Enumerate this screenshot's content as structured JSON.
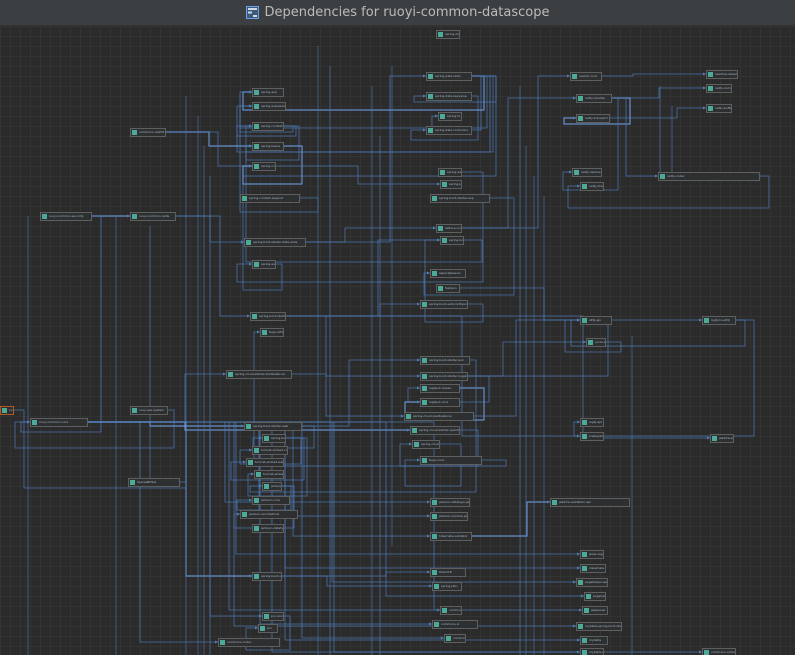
{
  "window": {
    "title": "Dependencies for ruoyi-common-datascope"
  },
  "colors": {
    "edge": "#4f7fbf",
    "edge_highlight": "#6e9fe6",
    "node_icon": "#4eaa98",
    "background": "#2b2b2b"
  },
  "nodes": [
    {
      "id": "n01",
      "label": "spring-aop"
    },
    {
      "id": "n02",
      "label": "spring-data-redis"
    },
    {
      "id": "n03",
      "label": "spring-data-keyvalue"
    },
    {
      "id": "n04",
      "label": "spring-tx"
    },
    {
      "id": "n05",
      "label": "spring-data-commons"
    },
    {
      "id": "n06",
      "label": "spring-oxm"
    },
    {
      "id": "n07",
      "label": "spring-context-support"
    },
    {
      "id": "n08",
      "label": "spring-expression"
    },
    {
      "id": "n09",
      "label": "spring-context"
    },
    {
      "id": "n10",
      "label": "spring-beans"
    },
    {
      "id": "n11",
      "label": "spring-core"
    },
    {
      "id": "n12",
      "label": "spring-jcl"
    },
    {
      "id": "n13",
      "label": "spring-webmvc"
    },
    {
      "id": "n14",
      "label": "spring-web"
    },
    {
      "id": "n15",
      "label": "ruoyi-common-security"
    },
    {
      "id": "n16",
      "label": "ruoyi-common-redis"
    },
    {
      "id": "n17",
      "label": "spring-boot-starter-data-redis"
    },
    {
      "id": "n18",
      "label": "spring-boot-starter-aop"
    },
    {
      "id": "n19",
      "label": "spring-boot-starter"
    },
    {
      "id": "n20",
      "label": "lettuce-core"
    },
    {
      "id": "n21",
      "label": "spring-boot"
    },
    {
      "id": "n22",
      "label": "reactor-core"
    },
    {
      "id": "n23",
      "label": "reactive-streams"
    },
    {
      "id": "n24",
      "label": "netty-handler"
    },
    {
      "id": "n25",
      "label": "netty-common"
    },
    {
      "id": "n26",
      "label": "netty-transport"
    },
    {
      "id": "n27",
      "label": "netty-buffer"
    },
    {
      "id": "n28",
      "label": "netty-codec"
    },
    {
      "id": "n29",
      "label": "netty-resolver"
    },
    {
      "id": "n30",
      "label": "netty-transport-native-unix-common"
    },
    {
      "id": "n31",
      "label": "aspectjweaver"
    },
    {
      "id": "n32",
      "label": "fastjson"
    },
    {
      "id": "n33",
      "label": "spring-boot-autoconfigure"
    },
    {
      "id": "n34",
      "label": "spring-boot-starter-json"
    },
    {
      "id": "n35",
      "label": "spring-boot-starter-logging"
    },
    {
      "id": "n36",
      "label": "logback-classic"
    },
    {
      "id": "n37",
      "label": "logback-core"
    },
    {
      "id": "n38",
      "label": "slf4j-api"
    },
    {
      "id": "n39",
      "label": "log4j-to-slf4j"
    },
    {
      "id": "n40",
      "label": "jul-to-slf4j"
    },
    {
      "id": "n41",
      "label": "log4j-api"
    },
    {
      "id": "n42",
      "label": "snakeyaml"
    },
    {
      "id": "n43",
      "label": "jakarta.annotation-api"
    },
    {
      "id": "n44",
      "label": "spring-cloud-starter-loadbalancer"
    },
    {
      "id": "n45",
      "label": "spring-cloud-loadbalancer"
    },
    {
      "id": "n46",
      "label": "spring-cloud-starter-openfeign"
    },
    {
      "id": "n47",
      "label": "spring-cloud-openfeign-core"
    },
    {
      "id": "n48",
      "label": "feign-core"
    },
    {
      "id": "n49",
      "label": "feign-slf4j"
    },
    {
      "id": "n50",
      "label": "ruoyi-api-system"
    },
    {
      "id": "n51",
      "label": "ruoyi-common-core"
    },
    {
      "id": "n52",
      "label": "ruoyi-common-datascope"
    },
    {
      "id": "n53",
      "label": "spring-boot-starter-web"
    },
    {
      "id": "n54",
      "label": "spring-boot-starter-tomcat"
    },
    {
      "id": "n55",
      "label": "tomcat-embed-core"
    },
    {
      "id": "n56",
      "label": "tomcat-embed-websocket"
    },
    {
      "id": "n57",
      "label": "tomcat-embed-el"
    },
    {
      "id": "n58",
      "label": "jackson-databind"
    },
    {
      "id": "n59",
      "label": "jackson-core"
    },
    {
      "id": "n60",
      "label": "jackson-annotations"
    },
    {
      "id": "n61",
      "label": "jackson-datatype-jdk8"
    },
    {
      "id": "n62",
      "label": "jackson-datatype-jsr310"
    },
    {
      "id": "n63",
      "label": "jackson-module-parameter-names"
    },
    {
      "id": "n64",
      "label": "hibernate-validator"
    },
    {
      "id": "n65",
      "label": "jakarta.validation-api"
    },
    {
      "id": "n66",
      "label": "jboss-logging"
    },
    {
      "id": "n67",
      "label": "classmate"
    },
    {
      "id": "n68",
      "label": "pagehelper-spring-boot-starter"
    },
    {
      "id": "n69",
      "label": "pagehelper"
    },
    {
      "id": "n70",
      "label": "jsqlparser"
    },
    {
      "id": "n71",
      "label": "mybatis-spring-boot-starter"
    },
    {
      "id": "n72",
      "label": "mybatis"
    },
    {
      "id": "n73",
      "label": "mybatis-spring"
    },
    {
      "id": "n74",
      "label": "spring-boot-starter-jdbc"
    },
    {
      "id": "n75",
      "label": "HikariCP"
    },
    {
      "id": "n76",
      "label": "spring-jdbc"
    },
    {
      "id": "n77",
      "label": "commons-lang3"
    },
    {
      "id": "n78",
      "label": "commons-io"
    },
    {
      "id": "n79",
      "label": "commons-fileupload"
    },
    {
      "id": "n80",
      "label": "poi-ooxml"
    },
    {
      "id": "n81",
      "label": "poi"
    },
    {
      "id": "n82",
      "label": "commons-codec"
    },
    {
      "id": "n83",
      "label": "commons-collections4"
    },
    {
      "id": "n84",
      "label": "commons-math3"
    },
    {
      "id": "n85",
      "label": "SparseBitSet"
    },
    {
      "id": "n86",
      "label": "poi-ooxml-lite"
    },
    {
      "id": "n87",
      "label": "xmlbeans"
    },
    {
      "id": "n88",
      "label": "commons-compress"
    },
    {
      "id": "n89",
      "label": "curvesapi"
    },
    {
      "id": "n90",
      "label": "transmittable-thread-local"
    },
    {
      "id": "n91",
      "label": "jjwt"
    },
    {
      "id": "n92",
      "label": "jaxb-api"
    },
    {
      "id": "n93",
      "label": "jakarta.activation-api"
    },
    {
      "id": "n94",
      "label": "swagger-annotations"
    },
    {
      "id": "n95",
      "label": "spring-cloud-commons"
    },
    {
      "id": "n96",
      "label": "spring-security-crypto"
    },
    {
      "id": "n97",
      "label": "spring-cloud-context"
    },
    {
      "id": "n98",
      "label": "spring-cloud-starter"
    },
    {
      "id": "n99",
      "label": "spring-security-rsa"
    },
    {
      "id": "n100",
      "label": "bcpkix-jdk15on"
    },
    {
      "id": "n101",
      "label": "bcprov-jdk15on"
    },
    {
      "id": "n102",
      "label": "evictor"
    },
    {
      "id": "n103",
      "label": "spring-boot-starter-cache"
    },
    {
      "id": "n104",
      "label": "caffeine"
    },
    {
      "id": "n105",
      "label": "checker-qual"
    },
    {
      "id": "n106",
      "label": "error_prone_annotations"
    },
    {
      "id": "n107",
      "label": "HdrHistogram"
    },
    {
      "id": "n108",
      "label": "LatencyUtils"
    },
    {
      "id": "n109",
      "label": "commons-pool2"
    },
    {
      "id": "n110",
      "label": "ruoyi-common-datasource"
    }
  ]
}
